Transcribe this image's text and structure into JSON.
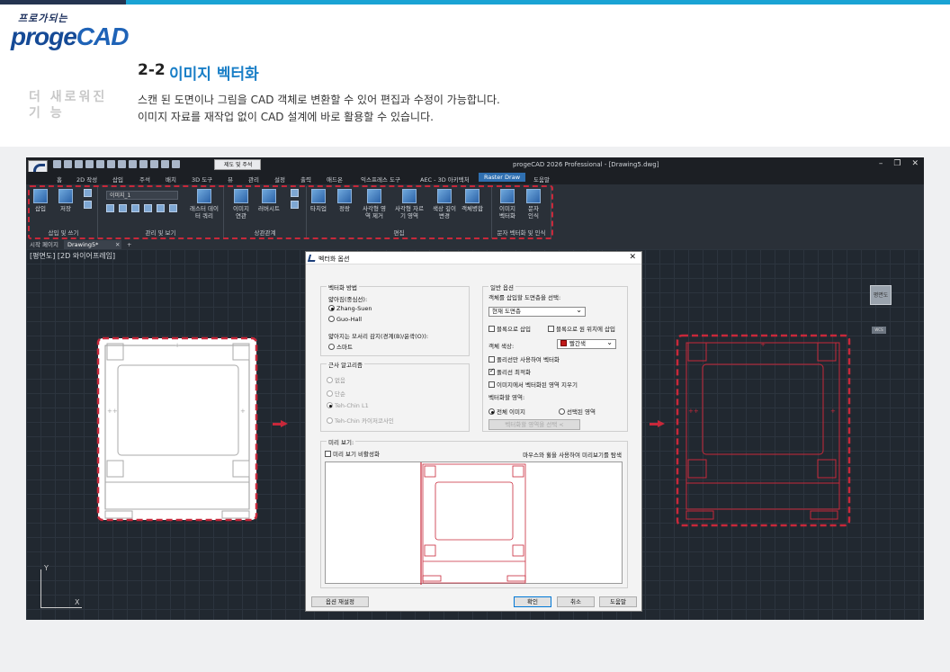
{
  "logo": {
    "sub": "프로가되는",
    "main_a": "proge",
    "main_b": "CAD"
  },
  "section": {
    "number": "2-2",
    "title": "이미지 벡터화"
  },
  "side_label": "더 새로워진 기 능",
  "description": [
    "스캔 된 도면이나 그림을 CAD 객체로 변환할 수 있어 편집과 수정이 가능합니다.",
    "이미지 자료를 재작업 없이 CAD 설계에 바로 활용할 수 있습니다."
  ],
  "cad": {
    "window_title": "progeCAD 2026 Professional - [Drawing5.dwg]",
    "qa_combo": "제도 및 주석",
    "menu": [
      "홈",
      "2D 작성",
      "삽입",
      "주석",
      "배치",
      "3D 도구",
      "뷰",
      "관리",
      "설정",
      "출력",
      "애드온",
      "익스프레스 도구",
      "AEC - 3D 아키텍처",
      "Raster Draw",
      "도움말"
    ],
    "ribbon": {
      "group_insert": {
        "title": "삽입 및 쓰기",
        "buttons": [
          "삽입",
          "저장"
        ]
      },
      "group_manage": {
        "title": "관리 및 보기",
        "combo": "이미지_1",
        "buttons": [
          "래스터 데이터 쿼리"
        ]
      },
      "group_relation": {
        "title": "상관관계",
        "buttons": [
          "이미지 연관",
          "러버시트"
        ]
      },
      "group_edit": {
        "title": "편집",
        "buttons": [
          "타치업",
          "정랑",
          "사각형 영역 제거",
          "사각형 자르기 영역",
          "색상 깊이 변경",
          "객체병합"
        ]
      },
      "group_vector": {
        "title": "문자 벡터화 및 인식",
        "buttons": [
          "이미지 벡터화",
          "문자 인식"
        ]
      }
    },
    "tabs": [
      "시작 페이지",
      "Drawing5*",
      "+"
    ],
    "view_label": "[평면도] [2D 와이어프레임]",
    "nav_cube": "평면도",
    "wcs": "WCS",
    "ucs_y": "Y",
    "ucs_x": "X",
    "win_controls": [
      "–",
      "❐",
      "✕"
    ]
  },
  "dialog": {
    "title": "벡터화 옵션",
    "close": "✕",
    "method": {
      "legend": "벡터화 방법",
      "thinning_label": "얇아짐(중심선):",
      "thinning_options": [
        "Zhang-Suen",
        "Guo-Hall"
      ],
      "edge_label": "얇아지는 모서리 감지(경계(B)/윤곽(O)):",
      "edge_options": [
        "스마트"
      ]
    },
    "approx": {
      "legend": "근사 알고리즘",
      "options": [
        "없음",
        "단순",
        "Teh-Chin L1",
        "Teh-Chin 카이저코사인"
      ]
    },
    "general": {
      "legend": "일반 옵션",
      "layer_label": "객체를 삽입할 도면층을 선택:",
      "layer_value": "현재 도면층",
      "insert_block": "블록으로 삽입",
      "insert_block_orig": "블록으로 원 위치에 삽입",
      "color_label": "객체 색상:",
      "color_value": "빨간색",
      "polyline_only": "폴리선만 사용하여 벡터화",
      "polyline_optimize": "폴리선 최적화",
      "erase_region": "이미지에서 벡터화된 영역 지우기",
      "area_label": "벡터화할 영역:",
      "area_all": "전체 이미지",
      "area_selected": "선택된 영역",
      "select_area_button": "벡터화할 영역을 선택 <"
    },
    "preview": {
      "legend": "미리 보기:",
      "disable": "미리 보기 비활성화",
      "hint": "마우스와 휠을 사용하여 미리보기를 탐색"
    },
    "buttons": {
      "reset": "옵션 재설정",
      "ok": "확인",
      "cancel": "취소",
      "help": "도움말"
    }
  },
  "colors": {
    "accent": "#1aa3d4",
    "highlight": "#c8283a",
    "vector_red": "#c8283a"
  }
}
